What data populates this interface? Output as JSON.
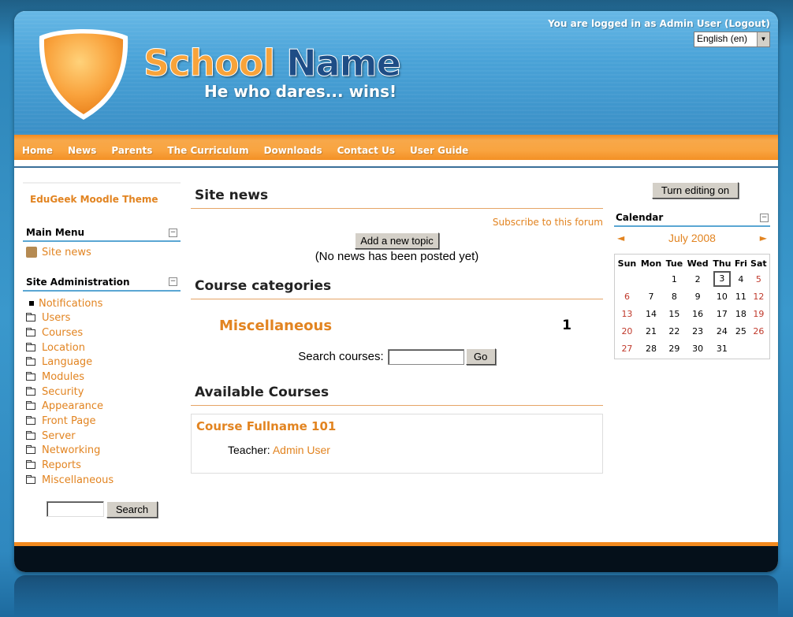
{
  "header": {
    "school_word1": "School",
    "school_word2": "Name",
    "motto": "He who dares... wins!",
    "login_prefix": "You are logged in as ",
    "login_user": "Admin User",
    "logout_text": "(Logout)",
    "language": "English (en)"
  },
  "nav": {
    "items": [
      "Home",
      "News",
      "Parents",
      "The Curriculum",
      "Downloads",
      "Contact Us",
      "User Guide"
    ]
  },
  "left": {
    "theme_title": "EduGeek Moodle Theme",
    "main_menu": {
      "title": "Main Menu",
      "items": [
        "Site news"
      ]
    },
    "site_admin": {
      "title": "Site Administration",
      "items": [
        "Notifications",
        "Users",
        "Courses",
        "Location",
        "Language",
        "Modules",
        "Security",
        "Appearance",
        "Front Page",
        "Server",
        "Networking",
        "Reports",
        "Miscellaneous"
      ]
    },
    "search_button": "Search"
  },
  "main": {
    "site_news_title": "Site news",
    "subscribe": "Subscribe to this forum",
    "add_topic": "Add a new topic",
    "no_news": "(No news has been posted yet)",
    "categories_title": "Course categories",
    "category_name": "Miscellaneous",
    "category_count": "1",
    "search_label": "Search courses:",
    "go_button": "Go",
    "available_title": "Available Courses",
    "course_name": "Course Fullname 101",
    "teacher_label": "Teacher:",
    "teacher_name": "Admin User"
  },
  "right": {
    "edit_button": "Turn editing on",
    "calendar_title": "Calendar",
    "month": "July 2008",
    "prev": "◄",
    "next": "►",
    "weekdays": [
      "Sun",
      "Mon",
      "Tue",
      "Wed",
      "Thu",
      "Fri",
      "Sat"
    ],
    "weeks": [
      [
        "",
        "",
        "1",
        "2",
        "3",
        "4",
        "5"
      ],
      [
        "6",
        "7",
        "8",
        "9",
        "10",
        "11",
        "12"
      ],
      [
        "13",
        "14",
        "15",
        "16",
        "17",
        "18",
        "19"
      ],
      [
        "20",
        "21",
        "22",
        "23",
        "24",
        "25",
        "26"
      ],
      [
        "27",
        "28",
        "29",
        "30",
        "31",
        "",
        ""
      ]
    ],
    "today": "3"
  },
  "colors": {
    "accent_orange": "#e28421",
    "nav_orange": "#f28a1f",
    "header_blue": "#4aa3d8",
    "navy": "#1e4d86"
  }
}
